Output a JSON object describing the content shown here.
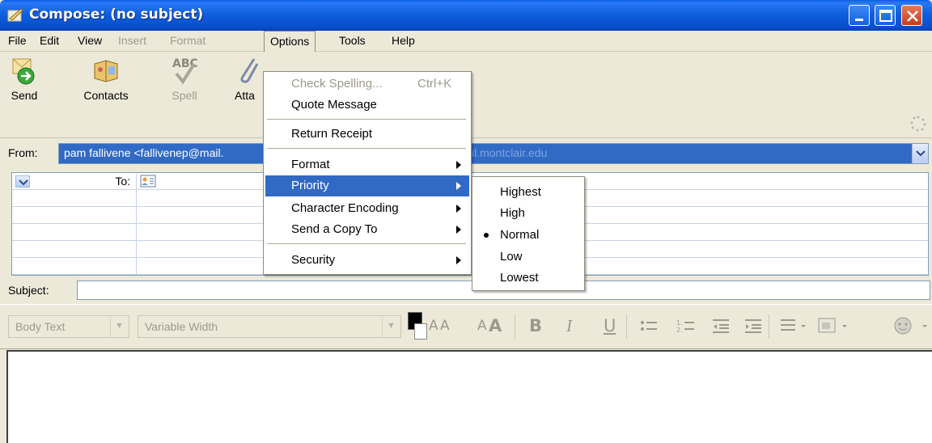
{
  "window": {
    "title": "Compose: (no subject)"
  },
  "menubar": {
    "items": [
      {
        "label": "File",
        "disabled": false
      },
      {
        "label": "Edit",
        "disabled": false
      },
      {
        "label": "View",
        "disabled": false
      },
      {
        "label": "Insert",
        "disabled": true
      },
      {
        "label": "Format",
        "disabled": true
      },
      {
        "label": "Options",
        "disabled": false,
        "open": true
      },
      {
        "label": "Tools",
        "disabled": false
      },
      {
        "label": "Help",
        "disabled": false
      }
    ]
  },
  "toolbar": {
    "send_label": "Send",
    "contacts_label": "Contacts",
    "spell_label": "Spell",
    "attach_label": "Atta"
  },
  "compose": {
    "from_label": "From:",
    "from_value": "pam fallivene <fallivenep@mail.",
    "from_value_tail": "il.montclair.edu",
    "to_label": "To:",
    "subject_label": "Subject:",
    "subject_value": ""
  },
  "format_toolbar": {
    "paragraph_style": "Body Text",
    "font": "Variable Width",
    "bold": "B",
    "italic": "I",
    "underline": "U",
    "smaller": "A",
    "larger": "A"
  },
  "options_menu": {
    "check_spelling": "Check Spelling...",
    "check_spelling_shortcut": "Ctrl+K",
    "quote_message": "Quote Message",
    "return_receipt": "Return Receipt",
    "format": "Format",
    "priority": "Priority",
    "character_encoding": "Character Encoding",
    "send_copy_to": "Send a Copy To",
    "security": "Security"
  },
  "priority_menu": {
    "items": [
      "Highest",
      "High",
      "Normal",
      "Low",
      "Lowest"
    ],
    "selected": "Normal"
  },
  "colors": {
    "titlebar": "#0a4fd0",
    "highlight": "#316ac5",
    "menu_bg": "#ece9d8"
  }
}
